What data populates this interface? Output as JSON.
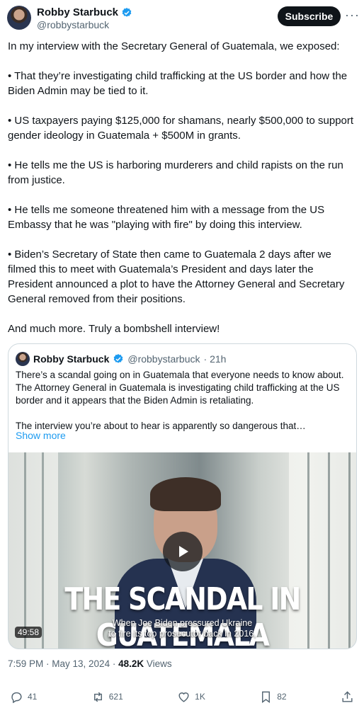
{
  "author": {
    "name": "Robby Starbuck",
    "handle": "@robbystarbuck",
    "subscribe_label": "Subscribe",
    "more_label": "···"
  },
  "tweet": {
    "paragraphs": [
      "In my interview with the Secretary General of Guatemala, we exposed:",
      "• That they’re investigating child trafficking at the US border and how the Biden Admin may be tied to it.",
      "• US taxpayers paying $125,000 for shamans, nearly $500,000 to support gender ideology in Guatemala + $500M in grants.",
      "• He tells me the US is harboring murderers and child rapists on the run from justice.",
      "• He tells me someone threatened him with a message from the US Embassy that he was \"playing with fire\" by doing this interview.",
      "• Biden’s Secretary of State then came to Guatemala 2 days after we filmed this to meet with Guatemala’s President and days later the President announced a plot to have the Attorney General and Secretary General removed from their positions.",
      "And much more. Truly a bombshell interview!"
    ]
  },
  "quote": {
    "name": "Robby Starbuck",
    "handle": "@robbystarbuck",
    "time": "· 21h",
    "text_1": "There’s a scandal going on in Guatemala that everyone needs to know about. The Attorney General in Guatemala is investigating child trafficking at the US border and it appears that the Biden Admin is retaliating.",
    "text_2": "The interview you’re about to hear is apparently so dangerous that…",
    "show_more": "Show more",
    "video": {
      "headline": "THE SCANDAL IN GUATEMALA",
      "caption_line_1": "When Joe Biden pressured Ukraine",
      "caption_line_2": "to fire its top prosecutor back in 2016,",
      "duration": "49:58"
    }
  },
  "meta": {
    "time": "7:59 PM · May 13, 2024 · ",
    "views_count": "48.2K",
    "views_label": " Views"
  },
  "actions": {
    "replies": "41",
    "reposts": "621",
    "likes": "1K",
    "bookmarks": "82"
  },
  "colors": {
    "text": "#0f1419",
    "secondary": "#536471",
    "accent": "#1d9bf0",
    "border": "#cfd9de"
  }
}
